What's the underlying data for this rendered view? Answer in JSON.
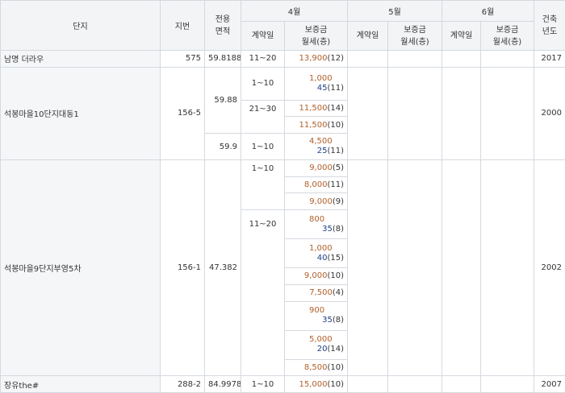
{
  "header": {
    "complex": "단지",
    "lot": "지번",
    "area": "전용\n면적",
    "months": [
      "4월",
      "5월",
      "6월"
    ],
    "contract_day": "계약일",
    "price": "보증금\n월세(층)",
    "built_year": "건축\n년도"
  },
  "rows": {
    "r1": {
      "name": "남명 더라우",
      "lot": "575",
      "area": "59.8188",
      "day": "11~20",
      "dep": "13,900",
      "cnt": "(12)",
      "year": "2017"
    },
    "r2": {
      "name": "석봉마을10단지대동1",
      "lot": "156-5",
      "area_a": "59.88",
      "area_b": "59.9",
      "year": "2000",
      "days": [
        "1~10",
        "21~30",
        "1~10"
      ],
      "items": [
        {
          "dep": "1,000",
          "rent": "45",
          "cnt": "(11)"
        },
        {
          "dep": "11,500",
          "cnt": "(14)"
        },
        {
          "dep": "11,500",
          "cnt": "(10)"
        },
        {
          "dep": "4,500",
          "rent": "25",
          "cnt": "(11)"
        }
      ]
    },
    "r3": {
      "name": "석봉마을9단지부영5차",
      "lot": "156-1",
      "area": "47.382",
      "year": "2002",
      "days": [
        "1~10",
        "11~20"
      ],
      "items": [
        {
          "dep": "9,000",
          "cnt": "(5)"
        },
        {
          "dep": "8,000",
          "cnt": "(11)"
        },
        {
          "dep": "9,000",
          "cnt": "(9)"
        },
        {
          "dep": "800",
          "rent": "35",
          "cnt": "(8)"
        },
        {
          "dep": "1,000",
          "rent": "40",
          "cnt": "(15)"
        },
        {
          "dep": "9,000",
          "cnt": "(10)"
        },
        {
          "dep": "7,500",
          "cnt": "(4)"
        },
        {
          "dep": "900",
          "rent": "35",
          "cnt": "(8)"
        },
        {
          "dep": "5,000",
          "rent": "20",
          "cnt": "(14)"
        },
        {
          "dep": "8,500",
          "cnt": "(10)"
        }
      ]
    },
    "r4": {
      "name": "장유the#",
      "lot": "288-2",
      "area": "84.9978",
      "day": "1~10",
      "dep": "15,000",
      "cnt": "(10)",
      "year": "2007"
    }
  }
}
